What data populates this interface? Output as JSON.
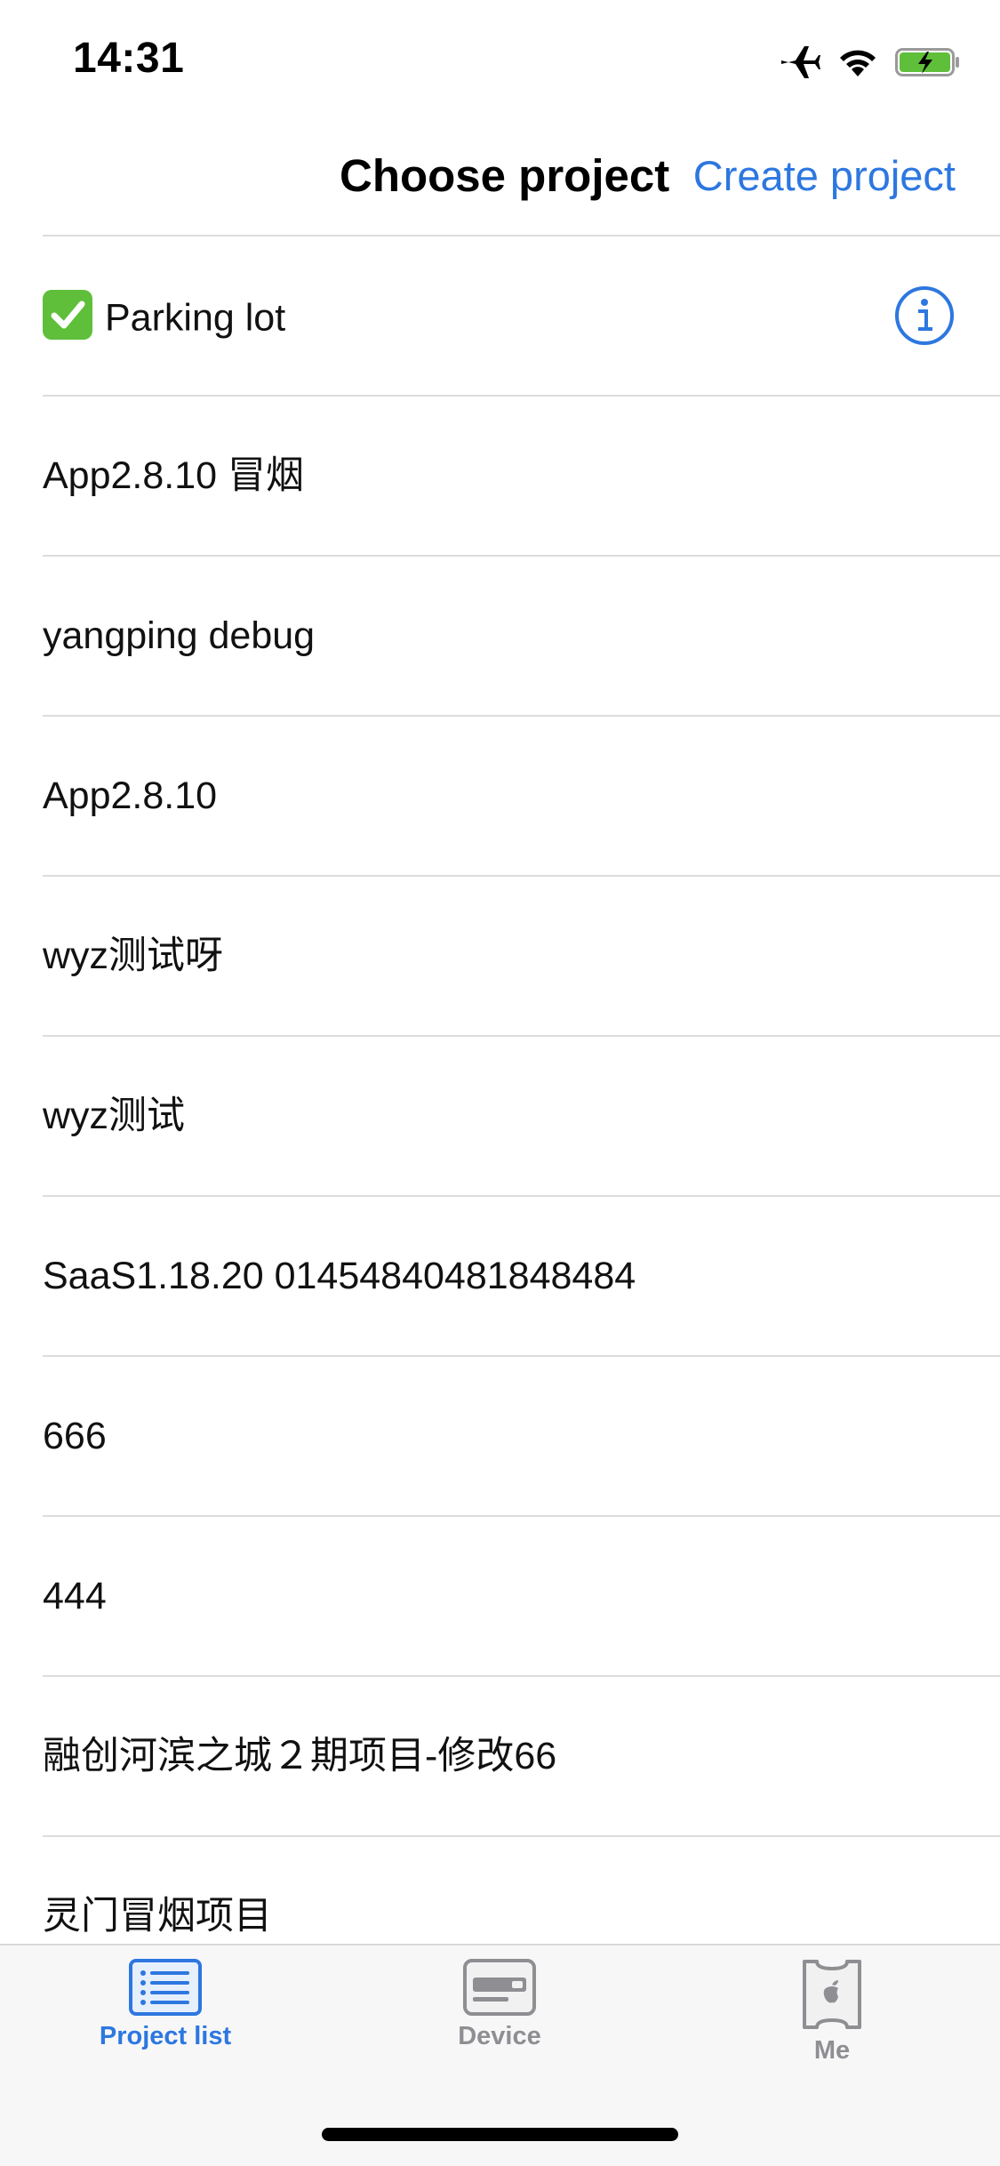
{
  "status_bar": {
    "time": "14:31",
    "icons": [
      "airplane-icon",
      "wifi-icon",
      "battery-charging-icon"
    ]
  },
  "nav": {
    "title": "Choose project",
    "action_label": "Create project"
  },
  "projects": [
    {
      "label": "Parking lot",
      "selected": true,
      "has_info": true
    },
    {
      "label": "App2.8.10 冒烟"
    },
    {
      "label": "yangping debug"
    },
    {
      "label": "App2.8.10"
    },
    {
      "label": "wyz测试呀"
    },
    {
      "label": "wyz测试"
    },
    {
      "label": "SaaS1.18.20 01454840481848484"
    },
    {
      "label": "666"
    },
    {
      "label": "444"
    },
    {
      "label": "融创河滨之城２期项目-修改66"
    },
    {
      "label": "灵门冒烟项目"
    }
  ],
  "tab_bar": {
    "tabs": [
      {
        "label": "Project list",
        "icon": "list-icon",
        "active": true
      },
      {
        "label": "Device",
        "icon": "device-icon",
        "active": false
      },
      {
        "label": "Me",
        "icon": "apple-badge-icon",
        "active": false
      }
    ]
  },
  "colors": {
    "accent": "#2d77e0",
    "inactive": "#8e8e93",
    "divider": "#dcdcdc",
    "check": "#5fbf3a",
    "battery": "#5fbf3a"
  }
}
